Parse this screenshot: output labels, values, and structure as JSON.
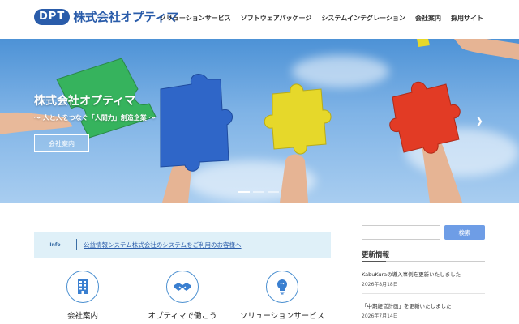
{
  "header": {
    "logo_badge": "DPT",
    "logo_text": "株式会社オプティマ",
    "nav": [
      "ソリューションサービス",
      "ソフトウェアパッケージ",
      "システムインテグレーション",
      "会社案内",
      "採用サイト"
    ]
  },
  "hero": {
    "title": "株式会社オプティマ",
    "subtitle": "〜 人と人をつなぐ「人間力」創造企業 〜",
    "button_label": "会社案内",
    "slide_count": 3,
    "active_slide": 1
  },
  "info": {
    "label": "Info",
    "link_text": "公益情報システム株式会社のシステムをご利用のお客様へ"
  },
  "features": [
    {
      "label": "会社案内",
      "icon": "building-icon"
    },
    {
      "label": "オプティマで働こう",
      "icon": "handshake-icon"
    },
    {
      "label": "ソリューションサービス",
      "icon": "lightbulb-icon"
    }
  ],
  "sidebar": {
    "search_placeholder": "",
    "search_button": "検索",
    "news_heading": "更新情報",
    "news": [
      {
        "title": "KabuKuraの導入事例を更新いたしました",
        "date": "2026年8月18日"
      },
      {
        "title": "「中期経営計画」を更新いたしました",
        "date": "2026年7月14日"
      }
    ]
  },
  "colors": {
    "brand": "#2a5caa",
    "accent": "#6e9de6",
    "info_bg": "#dff0f8"
  }
}
